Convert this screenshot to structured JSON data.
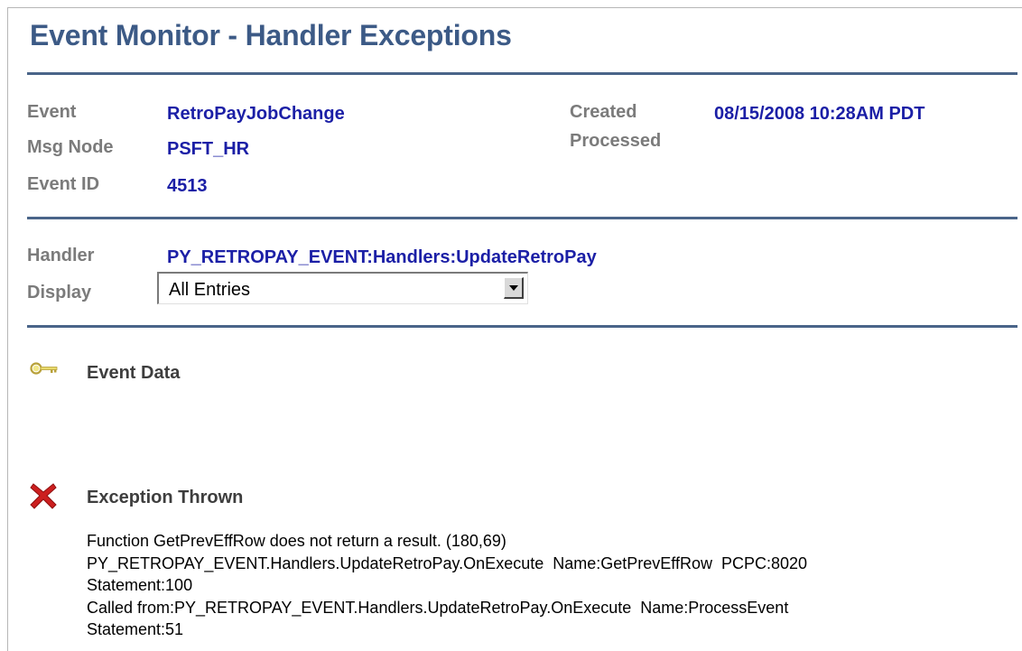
{
  "page": {
    "title": "Event Monitor - Handler Exceptions"
  },
  "event_info": {
    "event_label": "Event",
    "event_value": "RetroPayJobChange",
    "msg_node_label": "Msg Node",
    "msg_node_value": "PSFT_HR",
    "event_id_label": "Event ID",
    "event_id_value": "4513",
    "created_label": "Created",
    "created_value": "08/15/2008 10:28AM PDT",
    "processed_label": "Processed",
    "processed_value": ""
  },
  "handler_info": {
    "handler_label": "Handler",
    "handler_value": "PY_RETROPAY_EVENT:Handlers:UpdateRetroPay",
    "display_label": "Display",
    "display_selected": "All Entries"
  },
  "sections": {
    "event_data": {
      "title": "Event Data",
      "icon": "key-icon"
    },
    "exception": {
      "title": "Exception Thrown",
      "icon": "red-x-icon",
      "lines": [
        "Function GetPrevEffRow does not return a result. (180,69)",
        "PY_RETROPAY_EVENT.Handlers.UpdateRetroPay.OnExecute  Name:GetPrevEffRow  PCPC:8020",
        "Statement:100",
        "Called from:PY_RETROPAY_EVENT.Handlers.UpdateRetroPay.OnExecute  Name:ProcessEvent",
        "Statement:51"
      ]
    }
  },
  "colors": {
    "title": "#3c5a86",
    "rule": "#4a6589",
    "label": "#7b7b7b",
    "value": "#1b1fa6",
    "error": "#cc1f1f",
    "key": "#e8d96a"
  }
}
